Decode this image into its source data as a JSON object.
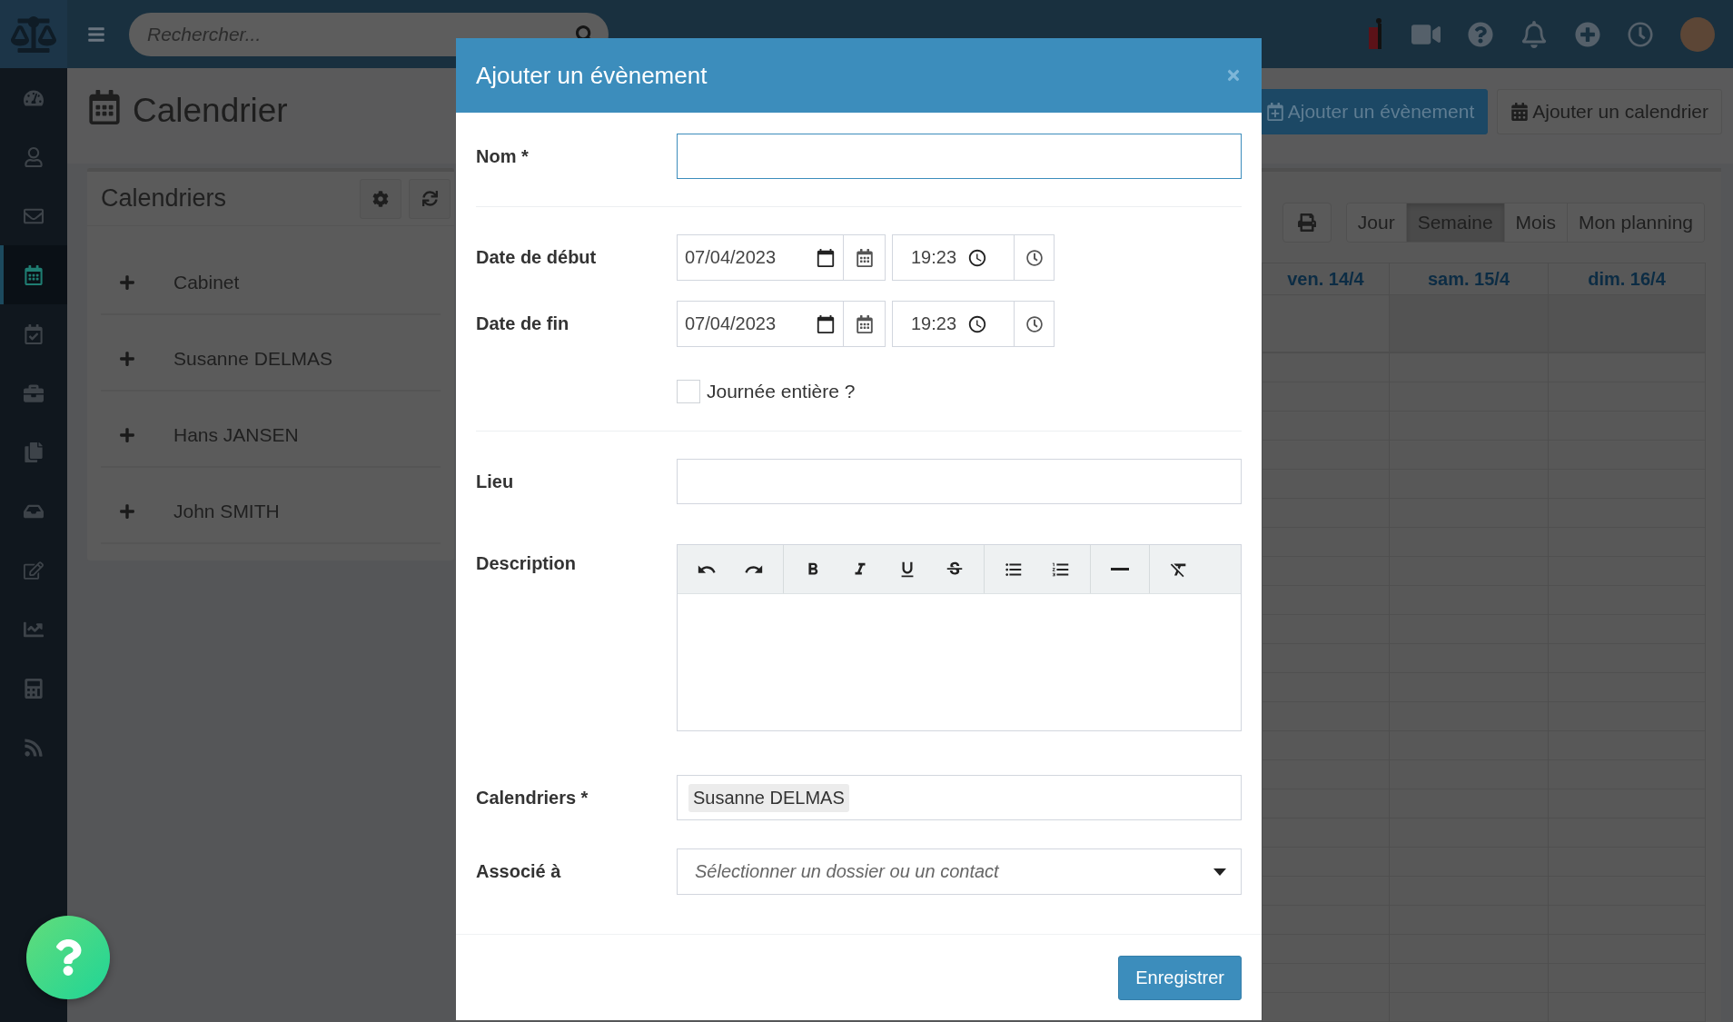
{
  "topbar": {
    "search": {
      "placeholder": "Rechercher..."
    }
  },
  "sidebar": {
    "items": [
      {
        "selected": false
      },
      {
        "selected": false
      },
      {
        "selected": false
      },
      {
        "selected": true
      },
      {
        "selected": false
      },
      {
        "selected": false
      },
      {
        "selected": false
      },
      {
        "selected": false
      },
      {
        "selected": false
      },
      {
        "selected": false
      },
      {
        "selected": false
      },
      {
        "selected": false
      }
    ]
  },
  "page": {
    "title": "Calendrier"
  },
  "calendars_panel": {
    "title": "Calendriers",
    "items": [
      {
        "label": "Cabinet"
      },
      {
        "label": "Susanne DELMAS"
      },
      {
        "label": "Hans JANSEN"
      },
      {
        "label": "John SMITH"
      }
    ]
  },
  "actions": [
    "Ajouter un évènement",
    "Ajouter un calendrier"
  ],
  "calendar": {
    "views": [
      {
        "label": "Jour",
        "selected": false
      },
      {
        "label": "Semaine",
        "selected": true
      },
      {
        "label": "Mois",
        "selected": false
      },
      {
        "label": "Mon planning",
        "selected": false
      }
    ],
    "days": [
      "ven. 14/4",
      "sam. 15/4",
      "dim. 16/4"
    ]
  },
  "modal": {
    "title": "Ajouter un évènement",
    "name": {
      "label": "Nom *",
      "focused": true
    },
    "start": {
      "label": "Date de début",
      "date": "07/04/2023",
      "time": "19:23"
    },
    "end": {
      "label": "Date de fin",
      "date": "07/04/2023",
      "time": "19:23"
    },
    "all_day": {
      "label": "Journée entière ?",
      "checked": false
    },
    "location": {
      "label": "Lieu"
    },
    "description": {
      "label": "Description"
    },
    "calendars": {
      "label": "Calendriers *",
      "tags": [
        "Susanne DELMAS"
      ]
    },
    "associated": {
      "label": "Associé à",
      "placeholder": "Sélectionner un dossier ou un contact"
    },
    "save": "Enregistrer"
  }
}
